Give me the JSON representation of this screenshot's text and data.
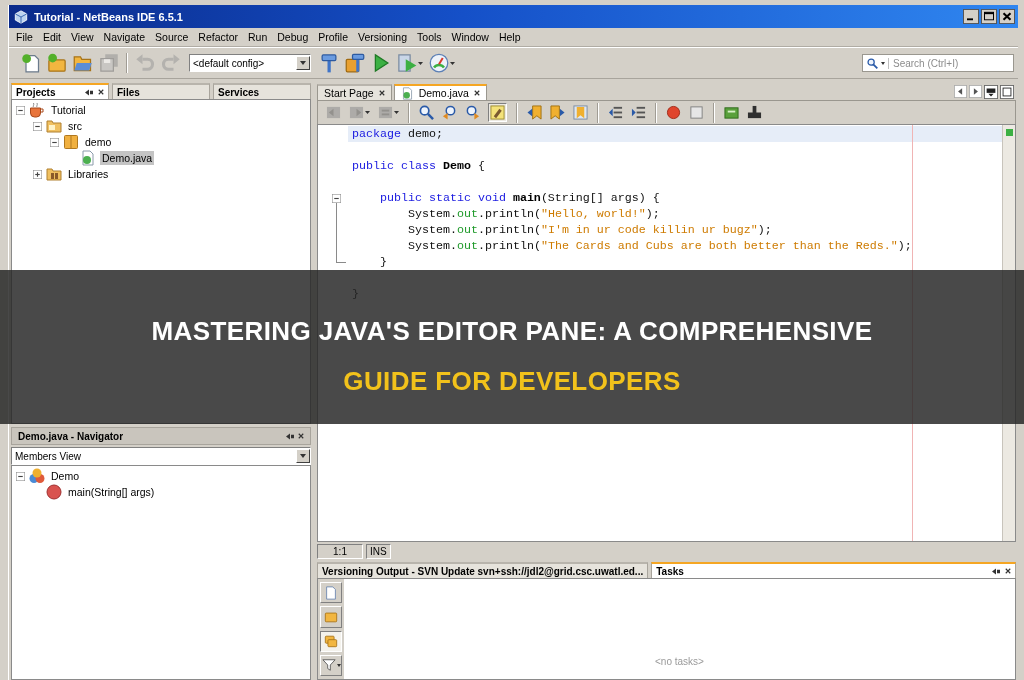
{
  "window": {
    "title": "Tutorial - NetBeans IDE 6.5.1"
  },
  "menu_bar": [
    "File",
    "Edit",
    "View",
    "Navigate",
    "Source",
    "Refactor",
    "Run",
    "Debug",
    "Profile",
    "Versioning",
    "Tools",
    "Window",
    "Help"
  ],
  "toolbar": {
    "buttons": [
      {
        "kind": "new-file",
        "disabled": false,
        "dropdown": false
      },
      {
        "kind": "new-project",
        "disabled": false,
        "dropdown": false
      },
      {
        "kind": "open-project",
        "disabled": false,
        "dropdown": false
      },
      {
        "kind": "save-all",
        "disabled": true,
        "dropdown": false
      },
      {
        "kind": "separator"
      },
      {
        "kind": "undo",
        "disabled": true,
        "dropdown": false
      },
      {
        "kind": "redo",
        "disabled": true,
        "dropdown": false
      }
    ],
    "config": {
      "value": "<default config>"
    },
    "run_buttons": [
      {
        "kind": "build",
        "disabled": false,
        "dropdown": false
      },
      {
        "kind": "clean-build",
        "disabled": false,
        "dropdown": false
      },
      {
        "kind": "run",
        "disabled": false,
        "dropdown": false
      },
      {
        "kind": "debug",
        "disabled": false,
        "dropdown": true
      },
      {
        "kind": "profile",
        "disabled": false,
        "dropdown": true
      }
    ],
    "search": {
      "placeholder": "Search (Ctrl+I)"
    }
  },
  "projects_panel": {
    "tabs": [
      {
        "label": "Projects",
        "selected": true
      },
      {
        "label": "Files",
        "selected": false
      },
      {
        "label": "Services",
        "selected": false
      }
    ],
    "tree": [
      {
        "label": "Tutorial",
        "kind": "project",
        "expanded": true,
        "selected": false,
        "children": [
          {
            "label": "src",
            "kind": "source-folder",
            "expanded": true,
            "selected": false,
            "children": [
              {
                "label": "demo",
                "kind": "package",
                "expanded": true,
                "selected": false,
                "children": [
                  {
                    "label": "Demo.java",
                    "kind": "java-file",
                    "selected": true
                  }
                ]
              }
            ]
          },
          {
            "label": "Libraries",
            "kind": "libraries",
            "expanded": false,
            "selected": false
          }
        ]
      }
    ]
  },
  "navigator": {
    "title": "Demo.java - Navigator",
    "view": "Members View",
    "tree": [
      {
        "label": "Demo",
        "kind": "class",
        "expanded": true,
        "selected": false,
        "children": [
          {
            "label": "main(String[] args)",
            "kind": "method",
            "selected": false
          }
        ]
      }
    ]
  },
  "editor": {
    "tabs": [
      {
        "label": "Start Page",
        "kind": "start-page",
        "selected": false
      },
      {
        "label": "Demo.java",
        "kind": "java-file",
        "selected": true
      }
    ],
    "toolbar": [
      {
        "kind": "back",
        "disabled": true,
        "dropdown": false,
        "pressed": false
      },
      {
        "kind": "forward",
        "disabled": true,
        "dropdown": true,
        "pressed": false
      },
      {
        "kind": "last-edit",
        "disabled": true,
        "dropdown": true,
        "pressed": false
      },
      {
        "kind": "separator"
      },
      {
        "kind": "find-selection",
        "disabled": false,
        "dropdown": false,
        "pressed": false
      },
      {
        "kind": "find-previous",
        "disabled": false,
        "dropdown": false,
        "pressed": false
      },
      {
        "kind": "find-next",
        "disabled": false,
        "dropdown": false,
        "pressed": false
      },
      {
        "kind": "toggle-highlight",
        "disabled": false,
        "dropdown": false,
        "pressed": true
      },
      {
        "kind": "separator"
      },
      {
        "kind": "previous-bookmark",
        "disabled": false,
        "dropdown": false,
        "pressed": false
      },
      {
        "kind": "next-bookmark",
        "disabled": false,
        "dropdown": false,
        "pressed": false
      },
      {
        "kind": "toggle-bookmark",
        "disabled": false,
        "dropdown": false,
        "pressed": false
      },
      {
        "kind": "separator"
      },
      {
        "kind": "shift-left",
        "disabled": false,
        "dropdown": false,
        "pressed": false
      },
      {
        "kind": "shift-right",
        "disabled": false,
        "dropdown": false,
        "pressed": false
      },
      {
        "kind": "separator"
      },
      {
        "kind": "start-macro",
        "disabled": false,
        "dropdown": false,
        "pressed": false
      },
      {
        "kind": "stop-macro",
        "disabled": false,
        "dropdown": false,
        "pressed": false
      },
      {
        "kind": "separator"
      },
      {
        "kind": "comment",
        "disabled": false,
        "dropdown": false,
        "pressed": false
      },
      {
        "kind": "uncomment",
        "disabled": false,
        "dropdown": false,
        "pressed": false
      }
    ],
    "lines": [
      {
        "kind": "code",
        "current": true,
        "tokens": [
          {
            "kind": "keyword",
            "text": "package"
          },
          {
            "kind": "plain",
            "text": " demo;"
          }
        ]
      },
      {
        "kind": "blank"
      },
      {
        "kind": "code",
        "tokens": [
          {
            "kind": "keyword",
            "text": "public class"
          },
          {
            "kind": "declaration",
            "text": " Demo"
          },
          {
            "kind": "plain",
            "text": " {"
          }
        ],
        "children": [
          {
            "kind": "blank"
          },
          {
            "kind": "code",
            "folded": false,
            "tokens": [
              {
                "kind": "keyword",
                "text": "public static void"
              },
              {
                "kind": "declaration",
                "text": " main"
              },
              {
                "kind": "plain",
                "text": "(String[] args) {"
              }
            ],
            "children": [
              {
                "kind": "code",
                "tokens": [
                  {
                    "kind": "plain",
                    "text": "System."
                  },
                  {
                    "kind": "field",
                    "text": "out"
                  },
                  {
                    "kind": "plain",
                    "text": ".println("
                  },
                  {
                    "kind": "string",
                    "text": "\"Hello, world!\""
                  },
                  {
                    "kind": "plain",
                    "text": ");"
                  }
                ]
              },
              {
                "kind": "code",
                "tokens": [
                  {
                    "kind": "plain",
                    "text": "System."
                  },
                  {
                    "kind": "field",
                    "text": "out"
                  },
                  {
                    "kind": "plain",
                    "text": ".println("
                  },
                  {
                    "kind": "string",
                    "text": "\"I'm in ur code killin ur bugz\""
                  },
                  {
                    "kind": "plain",
                    "text": ");"
                  }
                ]
              },
              {
                "kind": "code",
                "tokens": [
                  {
                    "kind": "plain",
                    "text": "System."
                  },
                  {
                    "kind": "field",
                    "text": "out"
                  },
                  {
                    "kind": "plain",
                    "text": ".println("
                  },
                  {
                    "kind": "string",
                    "text": "\"The Cards and Cubs are both better than the Reds.\""
                  },
                  {
                    "kind": "plain",
                    "text": ");"
                  }
                ]
              }
            ]
          },
          {
            "kind": "code",
            "tokens": [
              {
                "kind": "plain",
                "text": "}"
              }
            ]
          },
          {
            "kind": "blank"
          }
        ]
      },
      {
        "kind": "code",
        "tokens": [
          {
            "kind": "plain",
            "text": "}"
          }
        ]
      }
    ]
  },
  "status_bar": {
    "position": "1:1",
    "mode": "INS"
  },
  "output_panel": {
    "tabs": [
      {
        "label": "Versioning Output - SVN Update svn+ssh://jdl2@grid.csc.uwatl.ed...",
        "selected": false
      },
      {
        "label": "Tasks",
        "selected": true
      }
    ],
    "scope_buttons": [
      {
        "kind": "current-file",
        "selected": false,
        "dropdown": false
      },
      {
        "kind": "open-projects",
        "selected": false,
        "dropdown": false
      },
      {
        "kind": "all-projects",
        "selected": true,
        "dropdown": false
      },
      {
        "kind": "filter",
        "selected": false,
        "dropdown": true
      }
    ],
    "message": "<no tasks>"
  },
  "banner": {
    "lines": [
      {
        "text": "MASTERING JAVA'S EDITOR PANE: A COMPREHENSIVE",
        "highlighted": false
      },
      {
        "text": "GUIDE FOR DEVELOPERS",
        "highlighted": true
      }
    ]
  }
}
